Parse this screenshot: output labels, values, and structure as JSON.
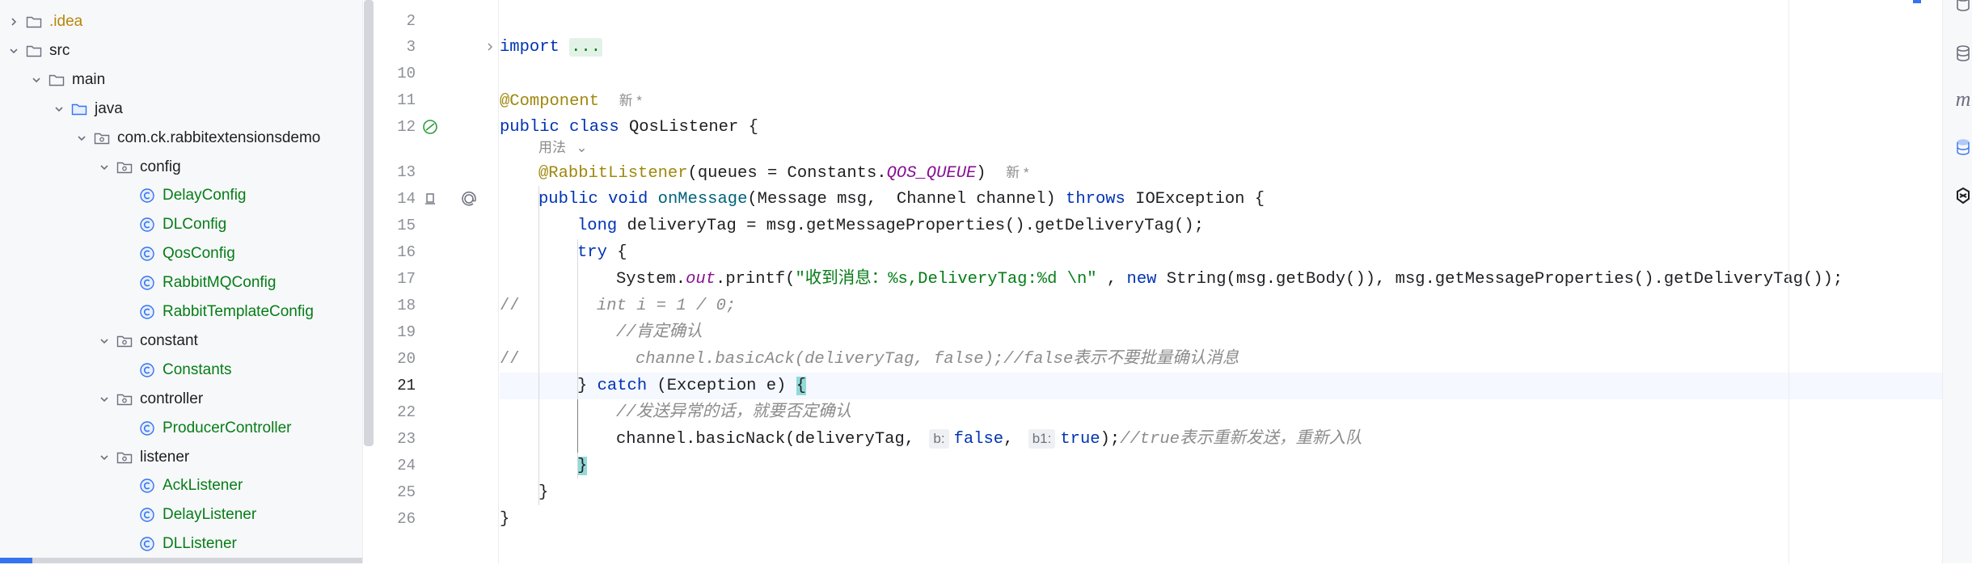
{
  "colors": {
    "keyword": "#0033b3",
    "annotation": "#9e880d",
    "method": "#00627a",
    "string": "#067d17",
    "constant": "#871094",
    "comment": "#8c8c8c",
    "class_name": "#067d17",
    "folder": "#6c707e",
    "accent": "#3574f0"
  },
  "tree": {
    "items": [
      {
        "label": ".idea",
        "icon": "folder-icon",
        "state": "collapsed",
        "color": "orange"
      },
      {
        "label": "src",
        "icon": "folder-icon",
        "state": "expanded"
      },
      {
        "label": "main",
        "icon": "folder-icon",
        "state": "expanded"
      },
      {
        "label": "java",
        "icon": "source-folder-icon",
        "state": "expanded"
      },
      {
        "label": "com.ck.rabbitextensionsdemo",
        "icon": "package-icon",
        "state": "expanded"
      },
      {
        "label": "config",
        "icon": "package-icon",
        "state": "expanded"
      },
      {
        "label": "DelayConfig",
        "icon": "class-icon"
      },
      {
        "label": "DLConfig",
        "icon": "class-icon"
      },
      {
        "label": "QosConfig",
        "icon": "class-icon"
      },
      {
        "label": "RabbitMQConfig",
        "icon": "class-icon"
      },
      {
        "label": "RabbitTemplateConfig",
        "icon": "class-icon"
      },
      {
        "label": "constant",
        "icon": "package-icon",
        "state": "expanded"
      },
      {
        "label": "Constants",
        "icon": "class-icon"
      },
      {
        "label": "controller",
        "icon": "package-icon",
        "state": "expanded"
      },
      {
        "label": "ProducerController",
        "icon": "class-icon"
      },
      {
        "label": "listener",
        "icon": "package-icon",
        "state": "expanded"
      },
      {
        "label": "AckListener",
        "icon": "class-icon"
      },
      {
        "label": "DelayListener",
        "icon": "class-icon"
      },
      {
        "label": "DLListener",
        "icon": "class-icon"
      }
    ]
  },
  "editor": {
    "current_line": "21",
    "lines": [
      {
        "num": "2"
      },
      {
        "num": "3"
      },
      {
        "num": "10"
      },
      {
        "num": "11"
      },
      {
        "num": "12"
      },
      {
        "num": ""
      },
      {
        "num": "13"
      },
      {
        "num": "14"
      },
      {
        "num": "15"
      },
      {
        "num": "16"
      },
      {
        "num": "17"
      },
      {
        "num": "18"
      },
      {
        "num": "19"
      },
      {
        "num": "20"
      },
      {
        "num": "21"
      },
      {
        "num": "22"
      },
      {
        "num": "23"
      },
      {
        "num": "24"
      },
      {
        "num": "25"
      },
      {
        "num": "26"
      }
    ],
    "code": {
      "import_kw": "import",
      "import_fold": "...",
      "component_ann": "@Component",
      "new_hint_1": "新 *",
      "public_1": "public",
      "class_kw": "class",
      "class_name": "QosListener {",
      "usage_hint": "用法",
      "rabbit_listener_ann": "@RabbitListener",
      "queues_arg": "(queues = Constants.",
      "qos_queue": "QOS_QUEUE",
      "close_paren": ")",
      "new_hint_2": "新 *",
      "public_2": "public",
      "void_kw": "void",
      "on_message": "onMessage",
      "params": "(Message msg,  Channel channel) ",
      "throws_kw": "throws",
      "io_exception": " IOException {",
      "long_kw": "long",
      "delivery_tag_stmt": " deliveryTag = msg.getMessageProperties().getDeliveryTag();",
      "try_kw": "try",
      "try_brace": " {",
      "system": "System.",
      "out": "out",
      "printf": ".printf(",
      "format_str": "\"收到消息：%s,DeliveryTag:%d \\n\"",
      "printf_rest_1": " , ",
      "new_kw": "new",
      "printf_rest_2": " String(msg.getBody()), msg.getMessageProperties().getDeliveryTag());",
      "comment_18_prefix": "//",
      "comment_18_body": "int i = 1 / 0;",
      "comment_19": "//肯定确认",
      "comment_20_prefix": "//",
      "comment_20_body": "channel.basicAck(deliveryTag, false);//false表示不要批量确认消息",
      "catch_close": "} ",
      "catch_kw": "catch",
      "catch_rest": " (Exception e) ",
      "catch_brace": "{",
      "comment_22": "//发送异常的话，就要否定确认",
      "nack_call": "channel.basicNack(deliveryTag,",
      "inlay_b": "b:",
      "false_kw": "false",
      "comma": ",",
      "inlay_b1": "b1:",
      "true_kw": "true",
      "nack_end": ");",
      "comment_23": "//true表示重新发送，重新入队",
      "close_24": "}",
      "close_25": "}",
      "close_26": "}"
    }
  },
  "right_toolbar": {
    "icons": [
      "database-icon",
      "database-icon",
      "maven-icon",
      "database-icon",
      "ai-assistant-icon"
    ],
    "maven_label": "m"
  }
}
